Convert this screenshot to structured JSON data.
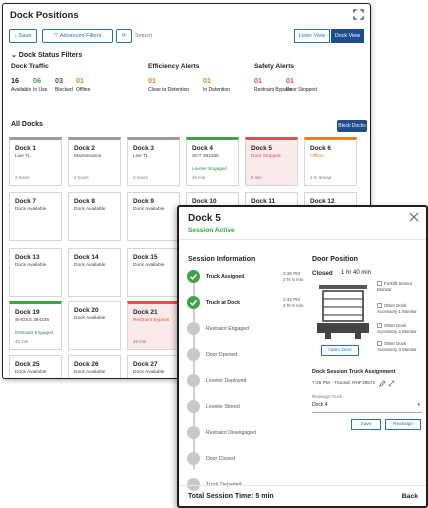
{
  "main": {
    "title": "Dock Positions",
    "toolbar": {
      "save": "↓ Save",
      "advanced_filters": "⊤ Advanced Filters",
      "reset": "⟳",
      "search_placeholder": "Search",
      "list_view": "Lister View",
      "dock_view": "Dock View"
    },
    "filters_title": "⌄ Dock Status Filters",
    "groups": {
      "traffic": "Dock Traffic",
      "efficiency": "Efficiency Alerts",
      "safety": "Safety Alerts"
    },
    "stats": [
      {
        "num": "16",
        "label": "Available",
        "color": "#222222"
      },
      {
        "num": "06",
        "label": "In Use",
        "color": "#3fa14a"
      },
      {
        "num": "03",
        "label": "Blocked",
        "color": "#555555"
      },
      {
        "num": "01",
        "label": "Offline",
        "color": "#e0822b"
      },
      {
        "num": "01",
        "label": "Close to Detention",
        "color": "#e0822b"
      },
      {
        "num": "01",
        "label": "In Detention",
        "color": "#e0822b"
      },
      {
        "num": "01",
        "label": "Restraint Bypass",
        "color": "#d9534f"
      },
      {
        "num": "01",
        "label": "Door Stopped",
        "color": "#d9534f"
      }
    ],
    "all_docks": "All Docks",
    "block_docks": "Block Docks",
    "cards": [
      {
        "title": "Dock 1",
        "status": "Live TL",
        "sub": "",
        "foot": "2 hours"
      },
      {
        "title": "Dock 2",
        "status": "Maintenance",
        "sub": "",
        "foot": "2 hours"
      },
      {
        "title": "Dock 3",
        "status": "Live TL",
        "sub": "",
        "foot": "2 hours"
      },
      {
        "title": "Dock 4",
        "status": "SCT 394336",
        "sub": "Leveler Engaged",
        "foot": "45 min"
      },
      {
        "title": "Dock 5",
        "status": "Door Stopped",
        "sub": "",
        "foot": "5 min"
      },
      {
        "title": "Dock 6",
        "status": "Offline",
        "sub": "",
        "foot": "1 hr ahead"
      },
      {
        "title": "Dock 7",
        "status": "Dock Available",
        "sub": "",
        "foot": ""
      },
      {
        "title": "Dock 8",
        "status": "Dock Available",
        "sub": "",
        "foot": ""
      },
      {
        "title": "Dock 9",
        "status": "Dock Available",
        "sub": "",
        "foot": ""
      },
      {
        "title": "Dock 10",
        "status": "Dock Available",
        "sub": "",
        "foot": ""
      },
      {
        "title": "Dock 11",
        "status": "",
        "sub": "",
        "foot": ""
      },
      {
        "title": "Dock 12",
        "status": "",
        "sub": "",
        "foot": ""
      },
      {
        "title": "Dock 13",
        "status": "Dock Available",
        "sub": "",
        "foot": ""
      },
      {
        "title": "Dock 14",
        "status": "Dock Available",
        "sub": "",
        "foot": ""
      },
      {
        "title": "Dock 15",
        "status": "Dock Available",
        "sub": "",
        "foot": ""
      },
      {
        "title": "Dock 19",
        "status": "SHOSS 394336",
        "sub": "Restraint Engaged",
        "foot": "45 min"
      },
      {
        "title": "Dock 20",
        "status": "Dock Available",
        "sub": "",
        "foot": ""
      },
      {
        "title": "Dock 21",
        "status": "Restraint Bypass",
        "sub": "",
        "foot": "45 min"
      },
      {
        "title": "Dock 25",
        "status": "Dock Available",
        "sub": "",
        "foot": ""
      },
      {
        "title": "Dock 26",
        "status": "Dock Available",
        "sub": "",
        "foot": ""
      },
      {
        "title": "Dock 27",
        "status": "Dock Available",
        "sub": "",
        "foot": ""
      }
    ]
  },
  "modal": {
    "title": "Dock 5",
    "subtitle": "Session Active",
    "session_info": "Session Information",
    "door_position": "Door Position",
    "steps": [
      {
        "label": "Truck Assigned",
        "time1": "2:26 PM",
        "time2": "2 hr 5 min"
      },
      {
        "label": "Truck at Dock",
        "time1": "2:32 PM",
        "time2": "2 hr 5 min"
      },
      {
        "label": "Restraint Engaged",
        "time1": "",
        "time2": ""
      },
      {
        "label": "Door Opened",
        "time1": "",
        "time2": ""
      },
      {
        "label": "Leveler Deployed",
        "time1": "",
        "time2": ""
      },
      {
        "label": "Leveler Stored",
        "time1": "",
        "time2": ""
      },
      {
        "label": "Restraint Disengaged",
        "time1": "",
        "time2": ""
      },
      {
        "label": "Door Closed",
        "time1": "",
        "time2": ""
      },
      {
        "label": "Truck Departed",
        "time1": "",
        "time2": ""
      }
    ],
    "door_state": "Closed",
    "duration": "1 hr 40 min",
    "door_button": "Open Door",
    "sensors": [
      "Forklift Sensor Monitor",
      "Other Dock Accessory 1 Monitor",
      "Other Dock Accessory 2 Monitor",
      "Other Dock Accessory 3 Monitor"
    ],
    "assignment_title": "Dock Session Truck Assignment",
    "assignment_line": "7:26 PM · Truckid: RHFJ8572",
    "reassign_label": "Reassign Truck",
    "reassign_value": "Dock 4",
    "btn_save": "Save",
    "btn_reassign": "Reassign",
    "total": "Total Session Time: 5 min",
    "back": "Back"
  }
}
